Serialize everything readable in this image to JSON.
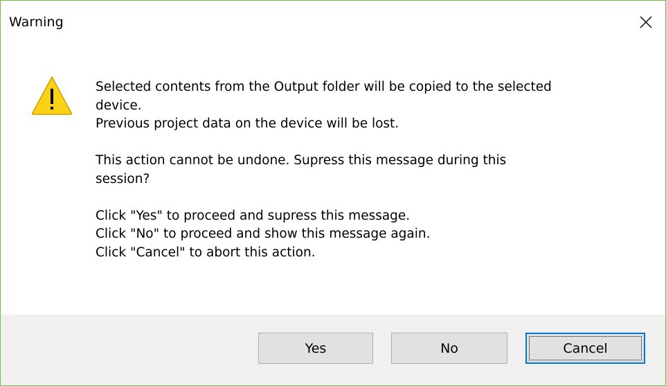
{
  "window": {
    "title": "Warning",
    "close_icon": "close-icon"
  },
  "icon": {
    "name": "warning-icon",
    "fill": "#fcd116",
    "stroke": "#c9a100",
    "glyph": "!"
  },
  "message": {
    "line1": "Selected contents from the Output folder will be copied to the selected\ndevice.\nPrevious project data on the device will be lost.",
    "line2": "This action cannot be undone. Supress this message during this\nsession?",
    "line3": "Click \"Yes\" to proceed and supress this message.\nClick \"No\" to proceed and show this message again.\nClick \"Cancel\" to abort this action."
  },
  "buttons": {
    "yes": "Yes",
    "no": "No",
    "cancel": "Cancel"
  },
  "colors": {
    "window_border": "#6cbf4a",
    "footer_bg": "#f0f0f0",
    "button_bg": "#e1e1e1",
    "button_border": "#adadad",
    "focus_border": "#0078d7"
  }
}
